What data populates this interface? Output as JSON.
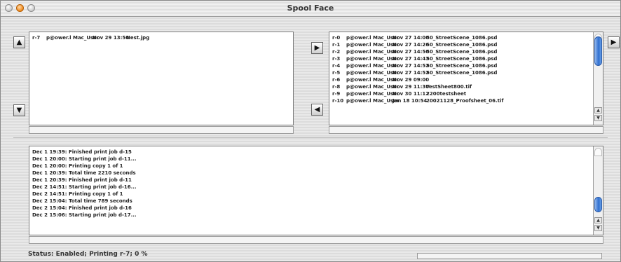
{
  "window": {
    "title": "Spool Face"
  },
  "left_queue": {
    "rows": [
      {
        "id": "r-7",
        "user": "p@ower.l Mac_User",
        "date": "Nov 29 13:50",
        "file": "Nest.jpg"
      }
    ]
  },
  "right_queue": {
    "rows": [
      {
        "id": "r-0",
        "user": "p@ower.l Mac_User",
        "date": "Nov 27 14:00",
        "file": "50_StreetScene_1086.psd"
      },
      {
        "id": "r-1",
        "user": "p@ower.l Mac_User",
        "date": "Nov 27 14:26",
        "file": "50_StreetScene_1086.psd"
      },
      {
        "id": "r-2",
        "user": "p@ower.l Mac_User",
        "date": "Nov 27 14:50",
        "file": "50_StreetScene_1086.psd"
      },
      {
        "id": "r-3",
        "user": "p@ower.l Mac_User",
        "date": "Nov 27 14:43",
        "file": "50_StreetScene_1086.psd"
      },
      {
        "id": "r-4",
        "user": "p@ower.l Mac_User",
        "date": "Nov 27 14:52",
        "file": "50_StreetScene_1086.psd"
      },
      {
        "id": "r-5",
        "user": "p@ower.l Mac_User",
        "date": "Nov 27 14:52",
        "file": "50_StreetScene_1086.psd"
      },
      {
        "id": "r-6",
        "user": "p@ower.l Mac_User",
        "date": "Nov 29 09:00",
        "file": ""
      },
      {
        "id": "r-8",
        "user": "p@ower.l Mac_User",
        "date": "Nov 29 11:30",
        "file": "TestSheet800.tif"
      },
      {
        "id": "r-9",
        "user": "p@ower.l Mac_User",
        "date": "Nov 30 11:12",
        "file": "2200testsheet"
      },
      {
        "id": "r-10",
        "user": "p@ower.l Mac_User",
        "date": "Jan 18 10:54",
        "file": "20021128_Proofsheet_06.tif"
      }
    ]
  },
  "log": {
    "lines": [
      "Dec 1 19:39: Finished print job d-15",
      "Dec 1 20:00: Starting print job d-11...",
      "Dec 1 20:00: Printing copy 1 of 1",
      "Dec 1 20:39: Total time 2210 seconds",
      "Dec 1 20:39: Finished print job d-11",
      "Dec 2 14:51: Starting print job d-16...",
      "Dec 2 14:51: Printing copy 1 of 1",
      "Dec 2 15:04: Total time 789 seconds",
      "Dec 2 15:04: Finished print job d-16",
      "Dec 2 15:06: Starting print job d-17..."
    ]
  },
  "status": {
    "text": "Status: Enabled; Printing r-7; 0 %",
    "progress_percent": 0
  },
  "icons": {
    "move_up": "▲",
    "move_down": "▼",
    "move_right": "▶",
    "move_left": "◀",
    "scroll_up": "▲",
    "scroll_down": "▼"
  },
  "colors": {
    "scroll_thumb": "#2f6fd0",
    "minimize_button": "#f08a1c"
  }
}
